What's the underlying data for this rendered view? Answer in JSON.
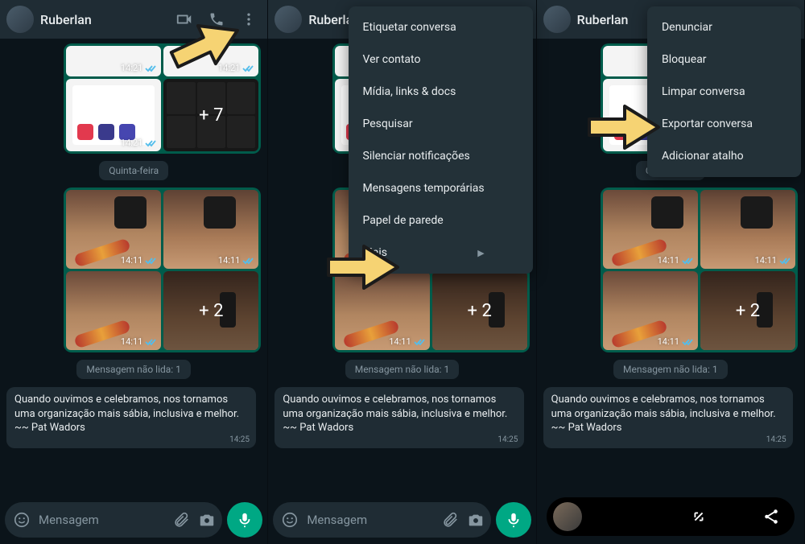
{
  "contact_name": "Ruberlan",
  "input": {
    "placeholder": "Mensagem"
  },
  "day_chip": "Quinta-feira",
  "unread_chip": "Mensagem não lida: 1",
  "quote": {
    "text": "Quando ouvimos e celebramos, nos tornamos uma organização mais sábia, inclusiva e melhor.",
    "author": "~~ Pat Wadors",
    "time": "14:25"
  },
  "times": {
    "top": "14:21",
    "grid": "14:11"
  },
  "overlays": {
    "top": "+ 7",
    "bottom": "+ 2"
  },
  "menu1": [
    "Etiquetar conversa",
    "Ver contato",
    "Mídia, links & docs",
    "Pesquisar",
    "Silenciar notificações",
    "Mensagens temporárias",
    "Papel de parede"
  ],
  "menu1_more": "Mais",
  "menu2": [
    "Denunciar",
    "Bloquear",
    "Limpar conversa",
    "Exportar conversa",
    "Adicionar atalho"
  ]
}
